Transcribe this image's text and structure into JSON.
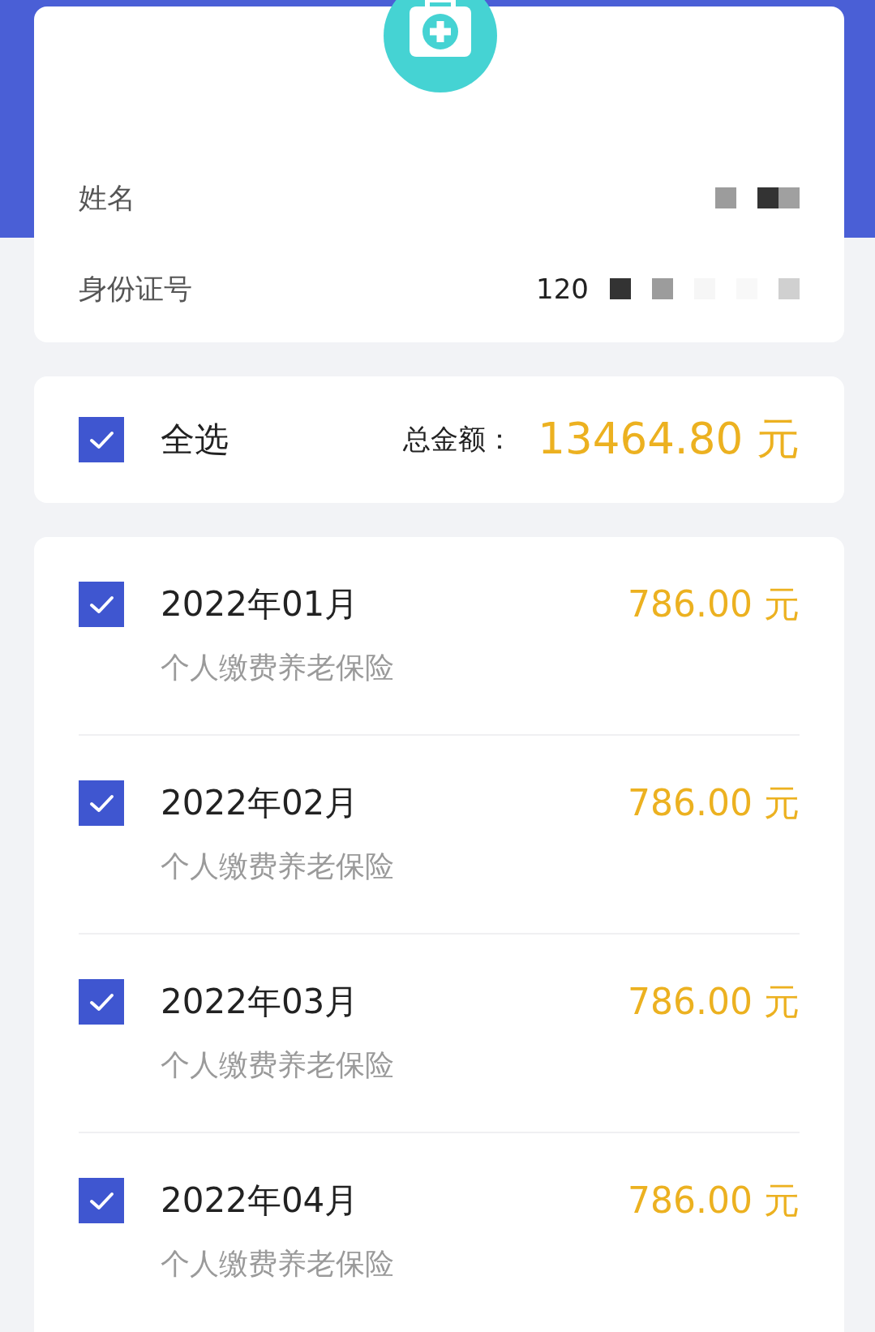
{
  "person": {
    "fields": [
      {
        "label": "姓名"
      },
      {
        "label": "身份证号",
        "value": "120"
      }
    ]
  },
  "select_all": {
    "label": "全选",
    "checked": true,
    "total_label": "总金额：",
    "total": "13464.80 元"
  },
  "bills": [
    {
      "month": "2022年01月",
      "type": "个人缴费养老保险",
      "amount": "786.00 元",
      "checked": true
    },
    {
      "month": "2022年02月",
      "type": "个人缴费养老保险",
      "amount": "786.00 元",
      "checked": true
    },
    {
      "month": "2022年03月",
      "type": "个人缴费养老保险",
      "amount": "786.00 元",
      "checked": true
    },
    {
      "month": "2022年04月",
      "type": "个人缴费养老保险",
      "amount": "786.00 元",
      "checked": true
    }
  ]
}
